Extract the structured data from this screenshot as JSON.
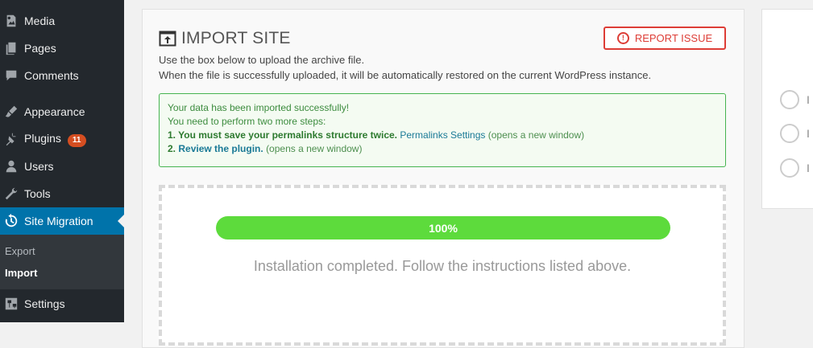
{
  "sidebar": {
    "items": [
      {
        "label": "Media",
        "icon": "media-icon"
      },
      {
        "label": "Pages",
        "icon": "pages-icon"
      },
      {
        "label": "Comments",
        "icon": "comments-icon"
      },
      {
        "label": "Appearance",
        "icon": "appearance-icon"
      },
      {
        "label": "Plugins",
        "icon": "plugins-icon",
        "badge": "11"
      },
      {
        "label": "Users",
        "icon": "users-icon"
      },
      {
        "label": "Tools",
        "icon": "tools-icon"
      },
      {
        "label": "Site Migration",
        "icon": "site-migration-icon",
        "current": true
      },
      {
        "label": "Settings",
        "icon": "settings-icon"
      }
    ],
    "submenu": [
      {
        "label": "Export"
      },
      {
        "label": "Import",
        "active": true
      }
    ]
  },
  "main": {
    "title": "IMPORT SITE",
    "report_button": "REPORT ISSUE",
    "description_line1": "Use the box below to upload the archive file.",
    "description_line2": "When the file is successfully uploaded, it will be automatically restored on the current WordPress instance.",
    "notice": {
      "line1": "Your data has been imported successfully!",
      "line2": "You need to perform two more steps:",
      "step1_bold": "1. You must save your permalinks structure twice.",
      "step1_link": "Permalinks Settings",
      "step1_note": "(opens a new window)",
      "step2_bold": "2.",
      "step2_link": "Review the plugin.",
      "step2_note": "(opens a new window)"
    },
    "progress": {
      "value": 1.0,
      "label": "100%"
    },
    "status_message": "Installation completed. Follow the instructions listed above."
  },
  "right_panel": {
    "options": [
      {
        "label": "I"
      },
      {
        "label": "I"
      },
      {
        "label": "I"
      }
    ]
  },
  "colors": {
    "sidebar_bg": "#23282d",
    "accent": "#0073aa",
    "progress": "#5ddb3c",
    "success_border": "#46b450",
    "danger": "#dd3d36"
  }
}
